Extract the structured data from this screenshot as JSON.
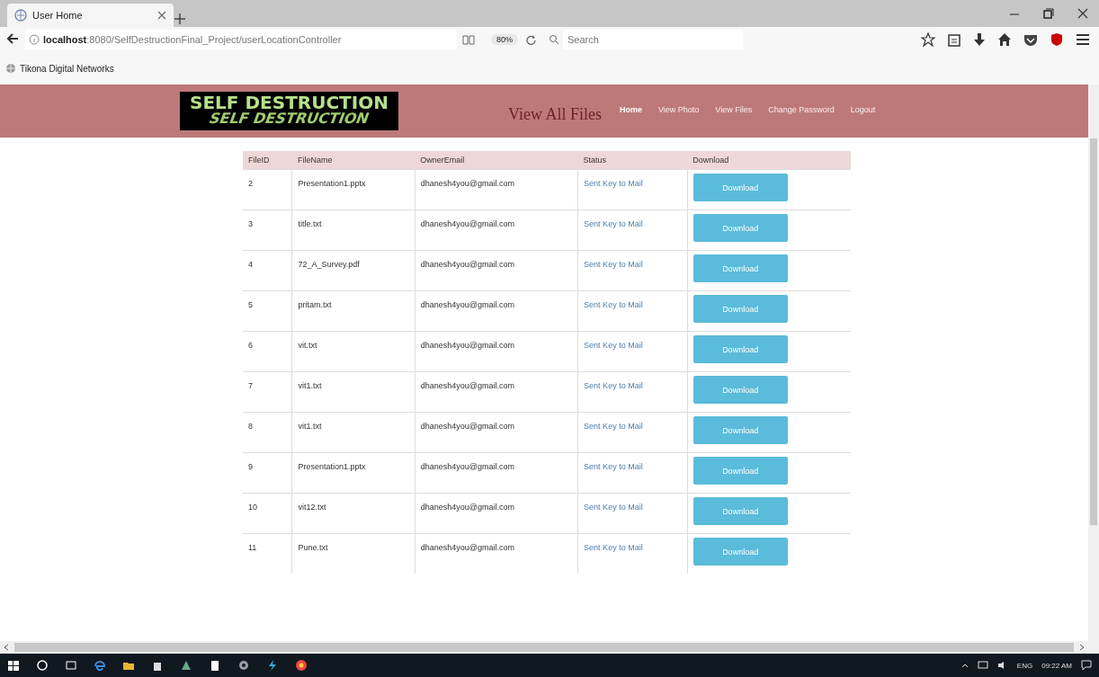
{
  "browser": {
    "tab_title": "User Home",
    "url_host": "localhost",
    "url_path": ":8080/SelfDestructionFinal_Project/userLocationController",
    "zoom": "80%",
    "search_placeholder": "Search",
    "bookmarks": [
      "Tikona Digital Networks"
    ]
  },
  "header": {
    "logo": {
      "title": "SELF DESTRUCTION",
      "reflection": "SELF DESTRUCTION"
    },
    "page_title": "View All Files",
    "nav": [
      {
        "label": "Home",
        "selected": true
      },
      {
        "label": "View Photo",
        "selected": false
      },
      {
        "label": "View Files",
        "selected": false
      },
      {
        "label": "Change Password",
        "selected": false
      },
      {
        "label": "Logout",
        "selected": false
      }
    ]
  },
  "table": {
    "columns": [
      "FileID",
      "FileName",
      "OwnerEmail",
      "Status",
      "Download"
    ],
    "rows": [
      {
        "id": "2",
        "name": "Presentation1.pptx",
        "email": "dhanesh4you@gmail.com",
        "status": "Sent Key to Mail",
        "action": "Download"
      },
      {
        "id": "3",
        "name": "title.txt",
        "email": "dhanesh4you@gmail.com",
        "status": "Sent Key to Mail",
        "action": "Download"
      },
      {
        "id": "4",
        "name": "72_A_Survey.pdf",
        "email": "dhanesh4you@gmail.com",
        "status": "Sent Key to Mail",
        "action": "Download"
      },
      {
        "id": "5",
        "name": "pritam.txt",
        "email": "dhanesh4you@gmail.com",
        "status": "Sent Key to Mail",
        "action": "Download"
      },
      {
        "id": "6",
        "name": "vit.txt",
        "email": "dhanesh4you@gmail.com",
        "status": "Sent Key to Mail",
        "action": "Download"
      },
      {
        "id": "7",
        "name": "vit1.txt",
        "email": "dhanesh4you@gmail.com",
        "status": "Sent Key to Mail",
        "action": "Download"
      },
      {
        "id": "8",
        "name": "vit1.txt",
        "email": "dhanesh4you@gmail.com",
        "status": "Sent Key to Mail",
        "action": "Download"
      },
      {
        "id": "9",
        "name": "Presentation1.pptx",
        "email": "dhanesh4you@gmail.com",
        "status": "Sent Key to Mail",
        "action": "Download"
      },
      {
        "id": "10",
        "name": "vit12.txt",
        "email": "dhanesh4you@gmail.com",
        "status": "Sent Key to Mail",
        "action": "Download"
      },
      {
        "id": "11",
        "name": "Pune.txt",
        "email": "dhanesh4you@gmail.com",
        "status": "Sent Key to Mail",
        "action": "Download"
      }
    ]
  },
  "taskbar": {
    "language": "ENG",
    "time": "09:22 AM"
  }
}
